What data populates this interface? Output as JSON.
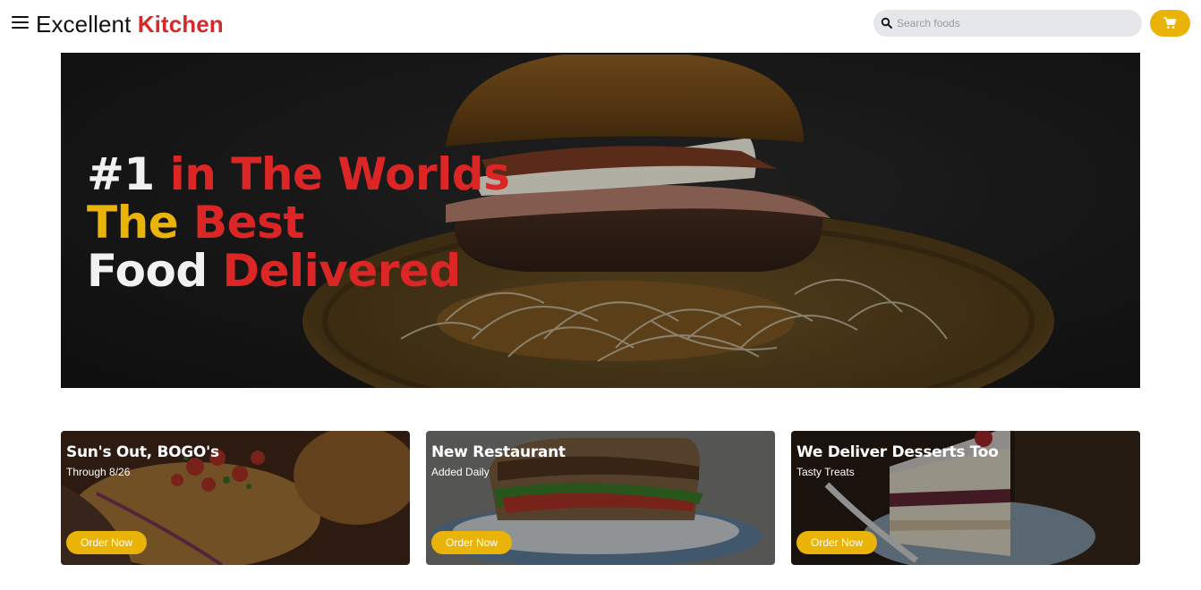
{
  "header": {
    "brand_part1": "Excellent",
    "brand_part2": "Kitchen",
    "search_placeholder": "Search foods",
    "menu_icon": "hamburger-menu-icon",
    "cart_icon": "shopping-cart-icon"
  },
  "hero": {
    "line1": {
      "a": "#1",
      "b": "in The Worlds"
    },
    "line2": {
      "a": "The",
      "b": "Best"
    },
    "line3": {
      "a": "Food",
      "b": "Delivered"
    }
  },
  "cards": [
    {
      "title": "Sun's Out, BOGO's",
      "subtitle": "Through 8/26",
      "button": "Order Now"
    },
    {
      "title": "New Restaurant",
      "subtitle": "Added Daily",
      "button": "Order Now"
    },
    {
      "title": "We Deliver Desserts Too",
      "subtitle": "Tasty Treats",
      "button": "Order Now"
    }
  ],
  "colors": {
    "accent_red": "#dc2626",
    "accent_yellow": "#eab308",
    "search_bg": "#e5e7eb"
  }
}
